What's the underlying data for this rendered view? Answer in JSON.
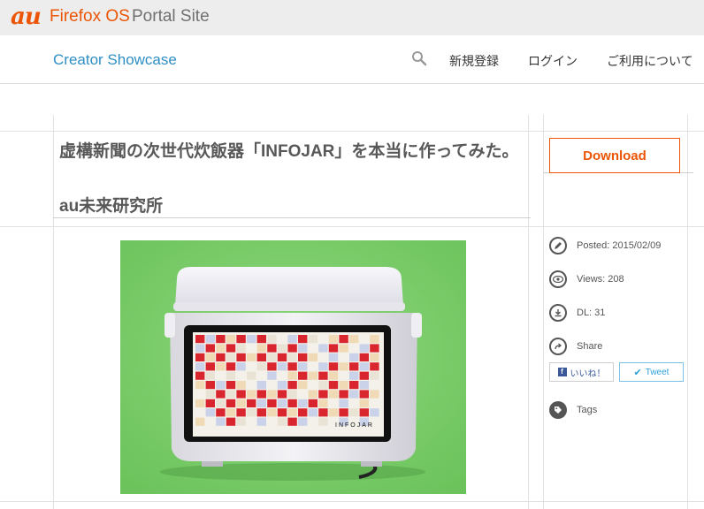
{
  "brand": {
    "au": "au",
    "firefox_os": "Firefox OS",
    "portal": "Portal Site"
  },
  "nav": {
    "title": "Creator Showcase",
    "links": [
      "新規登録",
      "ログイン",
      "ご利用について"
    ]
  },
  "article": {
    "title": "虚構新聞の次世代炊飯器「INFOJAR」を本当に作ってみた。",
    "author": "au未来研究所",
    "screen_brand": "INFOJAR"
  },
  "sidebar": {
    "download_label": "Download",
    "posted": "Posted: 2015/02/09",
    "views": "Views: 208",
    "dl": "DL: 31",
    "share": "Share",
    "like_label": "いいね！",
    "tweet_label": "Tweet",
    "tags": "Tags"
  },
  "colors": {
    "accent": "#eb5505",
    "link": "#2f8fc4",
    "photo_bg": "#7cce6c"
  }
}
